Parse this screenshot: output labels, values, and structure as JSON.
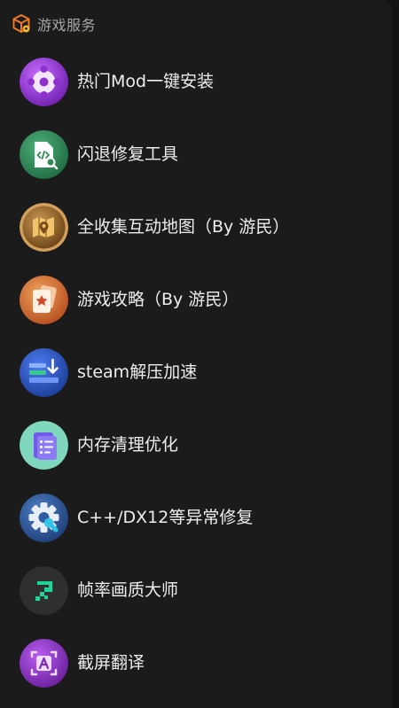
{
  "header": {
    "title": "游戏服务",
    "icon": "package-box-icon"
  },
  "items": [
    {
      "label": "热门Mod一键安装",
      "icon": "mod-puzzle-icon",
      "color": "#8e2fd0"
    },
    {
      "label": "闪退修复工具",
      "icon": "code-file-search-icon",
      "color": "#2f8a55"
    },
    {
      "label": "全收集互动地图（By 游民）",
      "icon": "map-pin-icon",
      "color": "#9a6a2c"
    },
    {
      "label": "游戏攻略（By 游民）",
      "icon": "guide-cards-icon",
      "color": "#d4733a"
    },
    {
      "label": "steam解压加速",
      "icon": "download-speed-icon",
      "color": "#2752b8"
    },
    {
      "label": "内存清理优化",
      "icon": "memory-clipboard-icon",
      "color": "#5fc7a6"
    },
    {
      "label": "C++/DX12等异常修复",
      "icon": "gear-wrench-icon",
      "color": "#2d5aa0"
    },
    {
      "label": "帧率画质大师",
      "icon": "fps-pixel-icon",
      "color": "#2e2e2e"
    },
    {
      "label": "截屏翻译",
      "icon": "screenshot-translate-icon",
      "color": "#8b2fc2"
    }
  ]
}
